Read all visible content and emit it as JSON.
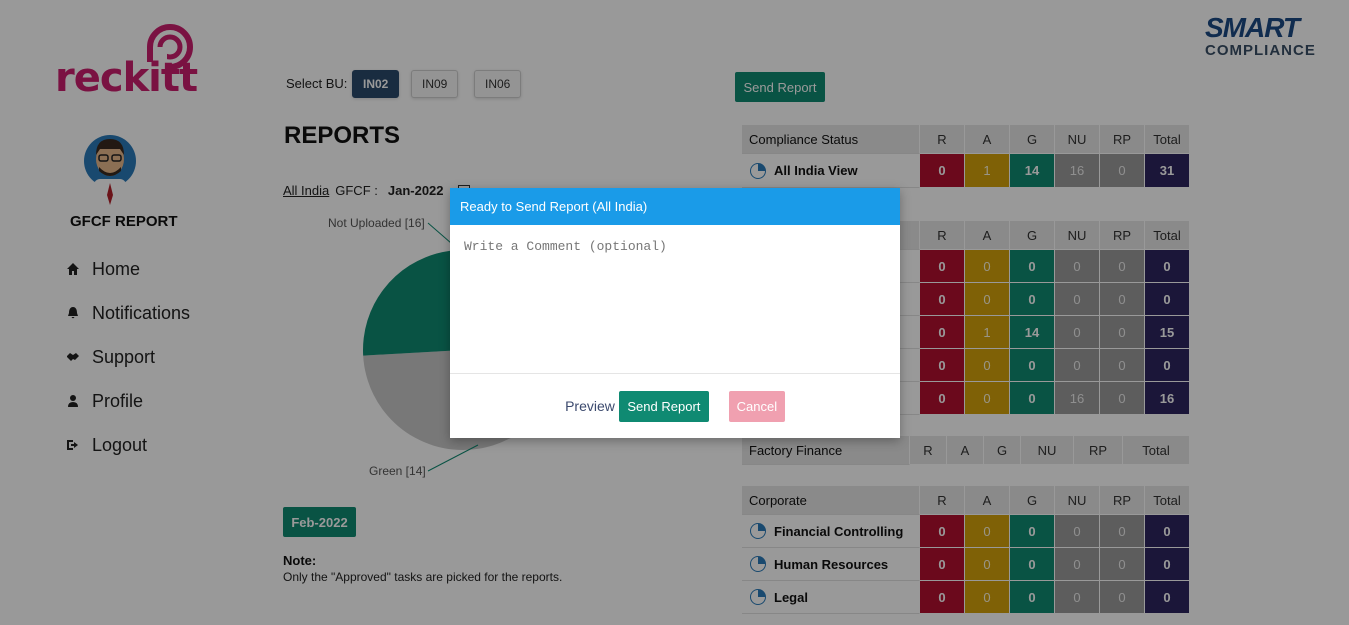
{
  "brand": {
    "logo_text": "reckitt",
    "partner_line1": "SMART",
    "partner_line2": "COMPLIANCE"
  },
  "sidebar": {
    "title": "GFCF REPORT",
    "items": [
      {
        "label": "Home",
        "icon": "home-icon"
      },
      {
        "label": "Notifications",
        "icon": "bell-icon"
      },
      {
        "label": "Support",
        "icon": "handshake-icon"
      },
      {
        "label": "Profile",
        "icon": "user-icon"
      },
      {
        "label": "Logout",
        "icon": "logout-icon"
      }
    ]
  },
  "bu": {
    "label": "Select BU:",
    "options": [
      "IN02",
      "IN09",
      "IN06"
    ],
    "selected": "IN02"
  },
  "reports": {
    "title": "REPORTS",
    "filter_link": "All India",
    "filter_label": "GFCF :",
    "month": "Jan-2022",
    "next_month_button": "Feb-2022",
    "note_title": "Note:",
    "note_text": "Only the \"Approved\" tasks are picked for the reports.",
    "send_report_button": "Send Report"
  },
  "pie": {
    "labels": [
      "Not Uploaded [16]",
      "Green [14]"
    ],
    "values": {
      "not_uploaded": 16,
      "green": 14,
      "amber": 1
    },
    "colors": {
      "not_uploaded": "#c8c8c8",
      "green": "#0f8a72",
      "amber": "#d4a20a"
    }
  },
  "tables": {
    "headers": [
      "R",
      "A",
      "G",
      "NU",
      "RP",
      "Total"
    ],
    "compliance": {
      "title": "Compliance Status",
      "rows": [
        {
          "name": "All India View",
          "values": [
            "0",
            "1",
            "14",
            "16",
            "0",
            "31"
          ]
        }
      ]
    },
    "section2": {
      "rows": [
        {
          "values": [
            "0",
            "0",
            "0",
            "0",
            "0",
            "0"
          ]
        },
        {
          "values": [
            "0",
            "0",
            "0",
            "0",
            "0",
            "0"
          ]
        },
        {
          "values": [
            "0",
            "1",
            "14",
            "0",
            "0",
            "15"
          ]
        },
        {
          "values": [
            "0",
            "0",
            "0",
            "0",
            "0",
            "0"
          ]
        },
        {
          "values": [
            "0",
            "0",
            "0",
            "16",
            "0",
            "16"
          ]
        }
      ]
    },
    "factory": {
      "title": "Factory Finance"
    },
    "corporate": {
      "title": "Corporate",
      "rows": [
        {
          "name": "Financial Controlling",
          "values": [
            "0",
            "0",
            "0",
            "0",
            "0",
            "0"
          ]
        },
        {
          "name": "Human Resources",
          "values": [
            "0",
            "0",
            "0",
            "0",
            "0",
            "0"
          ]
        },
        {
          "name": "Legal",
          "values": [
            "0",
            "0",
            "0",
            "0",
            "0",
            "0"
          ]
        }
      ]
    }
  },
  "modal": {
    "title": "Ready to Send Report (All India)",
    "placeholder": "Write a Comment (optional)",
    "value": "",
    "preview": "Preview",
    "send": "Send Report",
    "cancel": "Cancel"
  }
}
